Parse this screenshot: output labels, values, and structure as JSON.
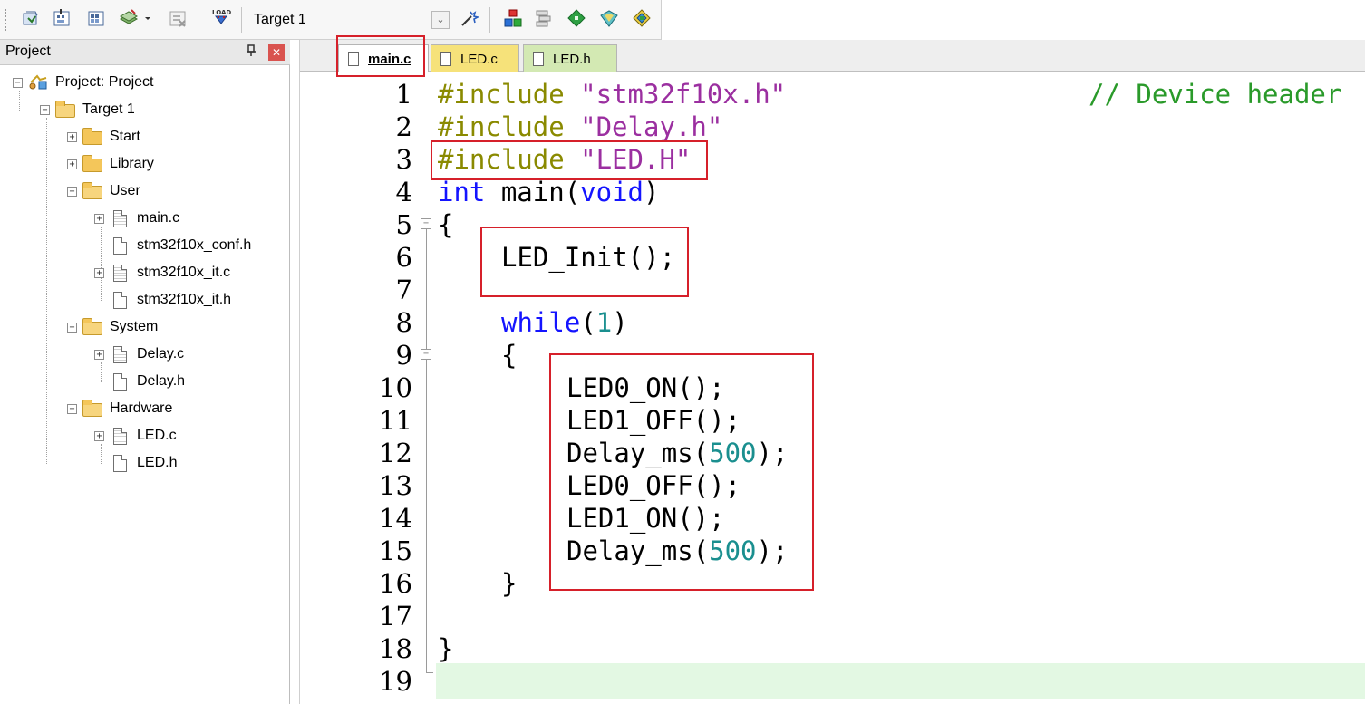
{
  "toolbar": {
    "target_label": "Target 1",
    "icons": [
      "translate-icon",
      "build-icon",
      "rebuild-icon",
      "batch-build-icon",
      "stop-build-icon",
      "download-icon",
      "target-options-icon",
      "manage-project-items-icon",
      "select-packs-icon",
      "manage-run-time-environment-icon",
      "pack-installer-icon",
      "components-icon"
    ]
  },
  "project_panel": {
    "title": "Project",
    "pin_glyph": "ᵽ",
    "close_glyph": "✕",
    "tree": {
      "root": "Project: Project",
      "target": "Target 1",
      "groups": [
        {
          "name": "Start",
          "expanded": false,
          "files": []
        },
        {
          "name": "Library",
          "expanded": false,
          "files": []
        },
        {
          "name": "User",
          "expanded": true,
          "files": [
            "main.c",
            "stm32f10x_conf.h",
            "stm32f10x_it.c",
            "stm32f10x_it.h"
          ]
        },
        {
          "name": "System",
          "expanded": true,
          "files": [
            "Delay.c",
            "Delay.h"
          ]
        },
        {
          "name": "Hardware",
          "expanded": true,
          "files": [
            "LED.c",
            "LED.h"
          ]
        }
      ]
    }
  },
  "editor": {
    "tabs": [
      {
        "label": "main.c",
        "active": true
      },
      {
        "label": "LED.c",
        "active": false
      },
      {
        "label": "LED.h",
        "active": false
      }
    ],
    "line_numbers": [
      "1",
      "2",
      "3",
      "4",
      "5",
      "6",
      "7",
      "8",
      "9",
      "10",
      "11",
      "12",
      "13",
      "14",
      "15",
      "16",
      "17",
      "18",
      "19"
    ],
    "code": {
      "l1_pp": "#include ",
      "l1_str": "\"stm32f10x.h\"",
      "l1_cmt": "// Device header",
      "l2_pp": "#include ",
      "l2_str": "\"Delay.h\"",
      "l3_pp": "#include ",
      "l3_str": "\"LED.H\"",
      "l4_kw1": "int",
      "l4_mid": " main(",
      "l4_kw2": "void",
      "l4_end": ")",
      "l5": "{",
      "l6": "LED_Init();",
      "l8_kw": "while",
      "l8_open": "(",
      "l8_num": "1",
      "l8_close": ")",
      "l9": "{",
      "l10": "LED0_ON();",
      "l11": "LED1_OFF();",
      "l12_a": "Delay_ms(",
      "l12_num": "500",
      "l12_b": ");",
      "l13": "LED0_OFF();",
      "l14": "LED1_ON();",
      "l15_a": "Delay_ms(",
      "l15_num": "500",
      "l15_b": ");",
      "l16": "}",
      "l18": "}"
    }
  },
  "colors": {
    "highlight_box": "#d6202a",
    "keyword": "#1414ff",
    "preprocessor": "#8a8a00",
    "string": "#9b2fa0",
    "number": "#1a8f8f",
    "comment": "#2a9a2a",
    "current_line": "#e3f8e3"
  }
}
